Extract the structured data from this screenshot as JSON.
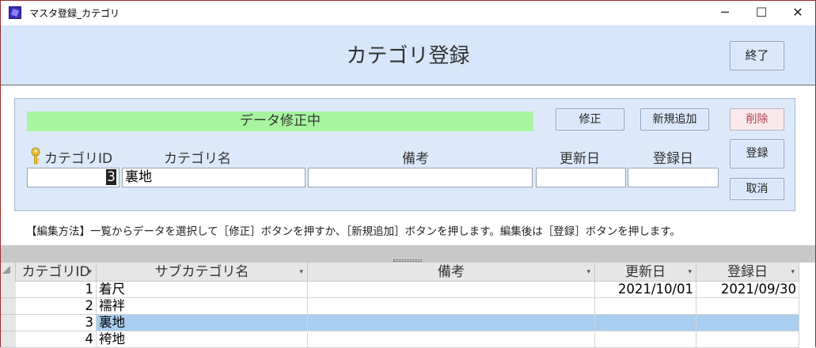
{
  "window": {
    "title": "マスタ登録_カテゴリ",
    "minimize_glyph": "─",
    "maximize_glyph": "☐",
    "close_glyph": "✕"
  },
  "header": {
    "title": "カテゴリ登録",
    "exit_label": "終了"
  },
  "edit": {
    "status": "データ修正中",
    "modify_label": "修正",
    "new_label": "新規追加",
    "delete_label": "削除",
    "register_label": "登録",
    "cancel_label": "取消",
    "labels": {
      "category_id": "カテゴリID",
      "category_name": "カテゴリ名",
      "remarks": "備考",
      "updated": "更新日",
      "registered": "登録日"
    },
    "values": {
      "category_id": "3",
      "category_name": "裏地",
      "remarks": "",
      "updated": "",
      "registered": ""
    }
  },
  "instruction": "【編集方法】一覧からデータを選択して［修正］ボタンを押すか、［新規追加］ボタンを押します。編集後は［登録］ボタンを押します。",
  "datasheet": {
    "columns": [
      "カテゴリID",
      "サブカテゴリ名",
      "備考",
      "更新日",
      "登録日"
    ],
    "dropdown_glyph": "▾",
    "rows": [
      {
        "id": "1",
        "name": "着尺",
        "remarks": "",
        "updated": "2021/10/01",
        "registered": "2021/09/30"
      },
      {
        "id": "2",
        "name": "襦袢",
        "remarks": "",
        "updated": "",
        "registered": ""
      },
      {
        "id": "3",
        "name": "裏地",
        "remarks": "",
        "updated": "",
        "registered": ""
      },
      {
        "id": "4",
        "name": "袴地",
        "remarks": "",
        "updated": "",
        "registered": ""
      }
    ],
    "selected_row": 2
  },
  "colors": {
    "header_bg": "#d6e6fb",
    "status_bg": "#a8f5a0",
    "selected_row_bg": "#a8cef0",
    "window_border": "#9a2b2b"
  }
}
